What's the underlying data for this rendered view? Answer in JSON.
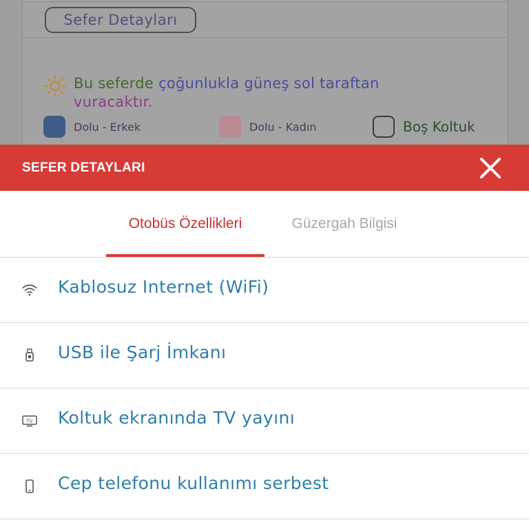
{
  "background": {
    "trip_details_button": "Sefer Detayları",
    "sun_notice": {
      "line1_a": "Bu seferde ",
      "line1_b": "çoğunlukla güneş sol taraftan",
      "line2": "vuracaktır."
    },
    "legend": [
      {
        "label": "Dolu - Erkek",
        "color": "#3e5c85"
      },
      {
        "label": "Dolu - Kadın",
        "color": "#b98a92"
      },
      {
        "label": "Boş Koltuk",
        "color": "#a3a3a3"
      }
    ]
  },
  "modal": {
    "title": "SEFER DETAYLARI",
    "close_icon": "close-icon",
    "tabs": [
      {
        "label": "Otobüs Özellikleri",
        "active": true
      },
      {
        "label": "Güzergah Bilgisi",
        "active": false
      }
    ],
    "features": [
      {
        "icon": "wifi-icon",
        "label": "Kablosuz Internet (WiFi)"
      },
      {
        "icon": "usb-icon",
        "label": "USB ile Şarj İmkanı"
      },
      {
        "icon": "tv-icon",
        "label": "Koltuk ekranında TV yayını"
      },
      {
        "icon": "phone-icon",
        "label": "Cep telefonu kullanımı serbest"
      }
    ]
  },
  "colors": {
    "header_red": "#d63b36",
    "active_tab_text": "#c8302d",
    "inactive_tab_text": "#a8a8a8",
    "dim_overlay": "#9e9e9e"
  }
}
